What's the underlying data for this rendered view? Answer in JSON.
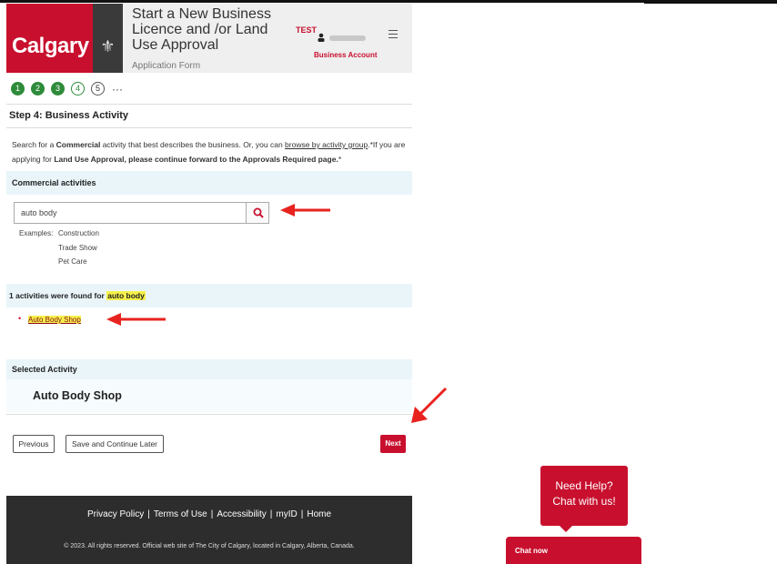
{
  "header": {
    "logo_text": "Calgary",
    "title": "Start a New Business Licence and /or Land Use Approval",
    "subtitle": "Application Form",
    "test_badge": "TEST",
    "account_label": "Business Account"
  },
  "steps": {
    "items": [
      {
        "label": "1",
        "state": "done"
      },
      {
        "label": "2",
        "state": "done"
      },
      {
        "label": "3",
        "state": "done"
      },
      {
        "label": "4",
        "state": "current"
      },
      {
        "label": "5",
        "state": "todo"
      }
    ],
    "more": "···"
  },
  "step_title": "Step 4: Business Activity",
  "intro": {
    "part1": "Search for a ",
    "bold1": "Commercial",
    "part2": " activity that best describes the business. Or, you can ",
    "link": "browse by activity group",
    "part3": ".*If you are applying for ",
    "bold2": "Land Use Approval, please continue forward to the Approvals Required page.",
    "part4": "*"
  },
  "commercial": {
    "heading": "Commercial activities",
    "search_value": "auto body",
    "examples_label": "Examples:",
    "examples": [
      "Construction",
      "Trade Show",
      "Pet Care"
    ]
  },
  "results": {
    "prefix": "1 activities were found for ",
    "query": "auto body",
    "items": [
      "Auto Body Shop"
    ]
  },
  "selected": {
    "heading": "Selected Activity",
    "value": "Auto Body Shop"
  },
  "buttons": {
    "previous": "Previous",
    "save": "Save and Continue Later",
    "next": "Next"
  },
  "footer": {
    "links": [
      "Privacy Policy",
      "Terms of Use",
      "Accessibility",
      "myID",
      "Home"
    ],
    "copyright": "© 2023. All rights reserved. Official web site of The City of Calgary, located in Calgary, Alberta, Canada."
  },
  "chat": {
    "bubble_line1": "Need Help?",
    "bubble_line2": "Chat with us!",
    "button": "Chat now"
  },
  "colors": {
    "brand_red": "#c8102e",
    "step_green": "#2e8b3a",
    "section_bg": "#eaf5fa",
    "highlight": "#f6f14a",
    "arrow_red": "#e8231f"
  }
}
